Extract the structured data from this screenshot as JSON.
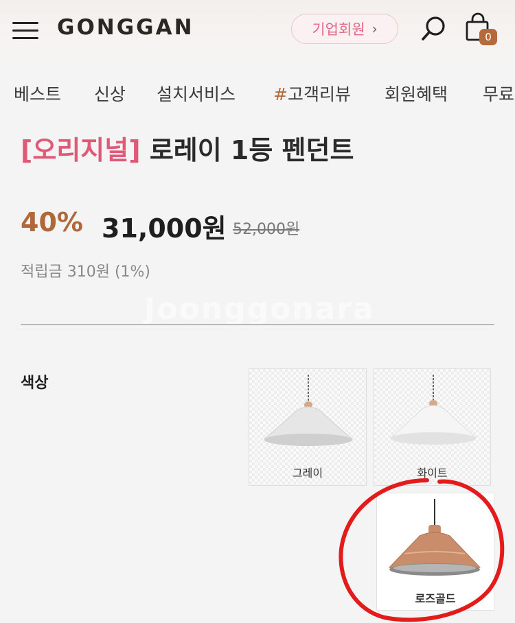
{
  "header": {
    "logo": "GONGGAN",
    "corporate_button": {
      "label": "기업회원",
      "chevron": "›"
    },
    "search_icon": "search-icon",
    "cart_icon": "shopping-bag-icon",
    "cart_count": "0",
    "menu_icon": "hamburger-icon"
  },
  "nav": {
    "items": [
      {
        "label": "베스트"
      },
      {
        "label": "신상"
      },
      {
        "label": "설치서비스"
      },
      {
        "hash": "#",
        "label": "고객리뷰"
      },
      {
        "label": "회원혜택"
      },
      {
        "label": "무료"
      }
    ]
  },
  "product": {
    "tag": "[오리지널]",
    "name": "로레이 1등 펜던트",
    "discount": "40%",
    "price": "31,000원",
    "original_price": "52,000원",
    "points": "적립금 310원 (1%)"
  },
  "watermark": "Joonggonara",
  "options": {
    "color_label": "색상",
    "swatches": [
      {
        "label": "그레이",
        "shade": "#e6e6e6"
      },
      {
        "label": "화이트",
        "shade": "#f5f5f5"
      },
      {
        "label": "로즈골드",
        "shade": "#c98d6c"
      }
    ]
  },
  "colors": {
    "accent_brown": "#b0683a",
    "tag_pink": "#e05a78",
    "annotation_red": "#e31b1b"
  }
}
